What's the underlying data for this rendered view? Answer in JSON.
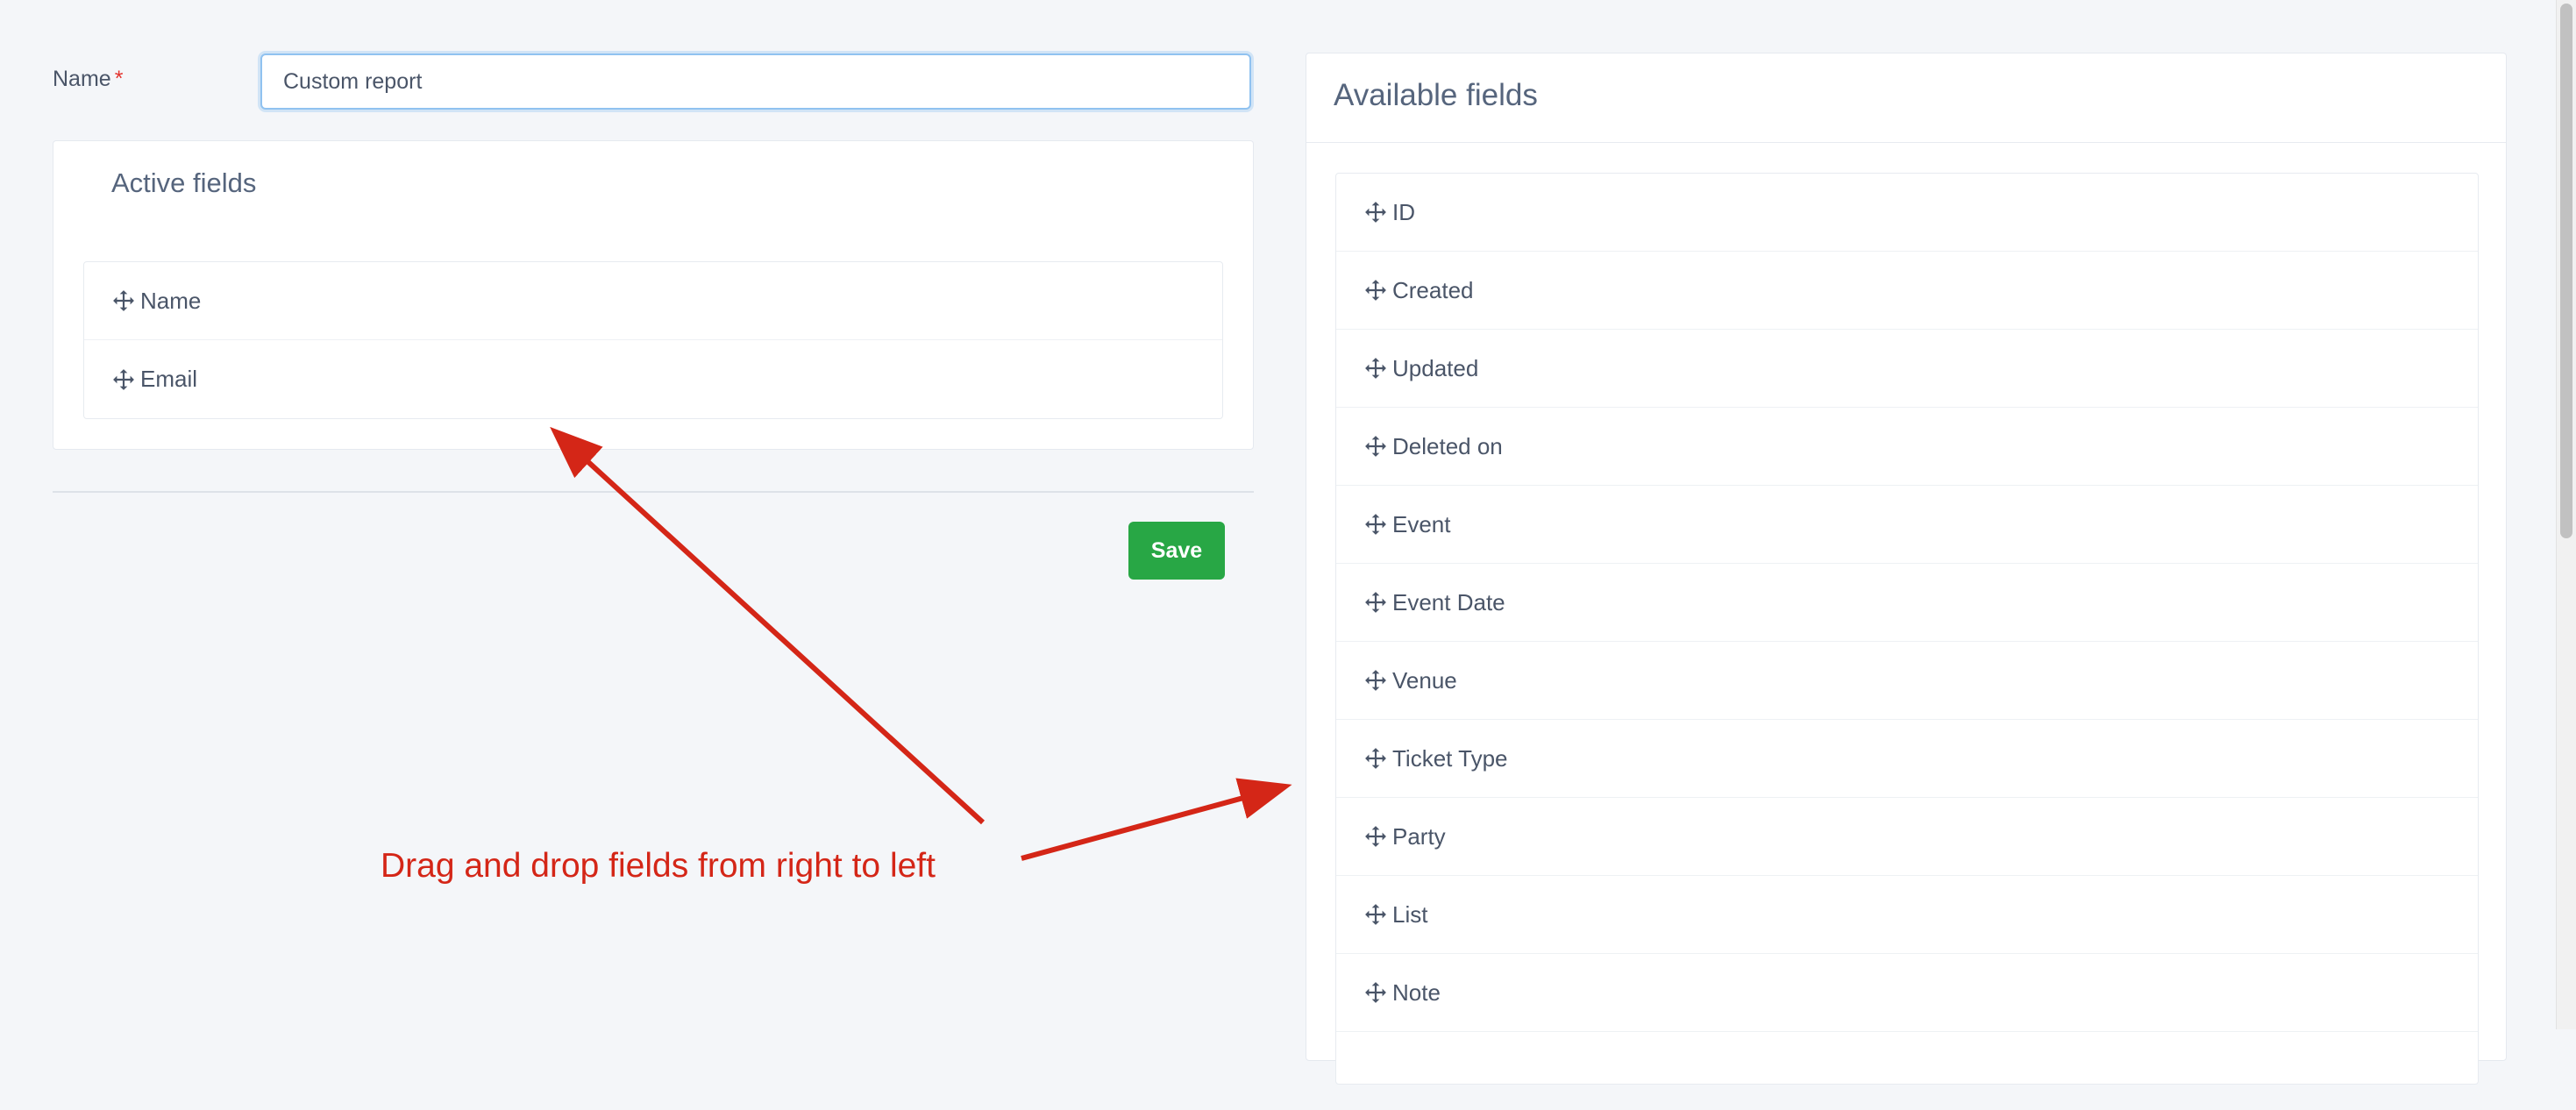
{
  "form": {
    "name_label": "Name",
    "required_mark": "*",
    "name_value": "Custom report"
  },
  "active": {
    "title": "Active fields",
    "items": [
      {
        "label": "Name"
      },
      {
        "label": "Email"
      }
    ]
  },
  "save_label": "Save",
  "available": {
    "title": "Available fields",
    "items": [
      {
        "label": "ID"
      },
      {
        "label": "Created"
      },
      {
        "label": "Updated"
      },
      {
        "label": "Deleted on"
      },
      {
        "label": "Event"
      },
      {
        "label": "Event Date"
      },
      {
        "label": "Venue"
      },
      {
        "label": "Ticket Type"
      },
      {
        "label": "Party"
      },
      {
        "label": "List"
      },
      {
        "label": "Note"
      },
      {
        "label": ""
      }
    ]
  },
  "annotation": "Drag and drop fields from right to left",
  "colors": {
    "accent_green": "#28a745",
    "annotation_red": "#d42617",
    "focus_blue": "#90c2f0"
  },
  "icons": {
    "drag_handle": "move-arrows-icon"
  }
}
